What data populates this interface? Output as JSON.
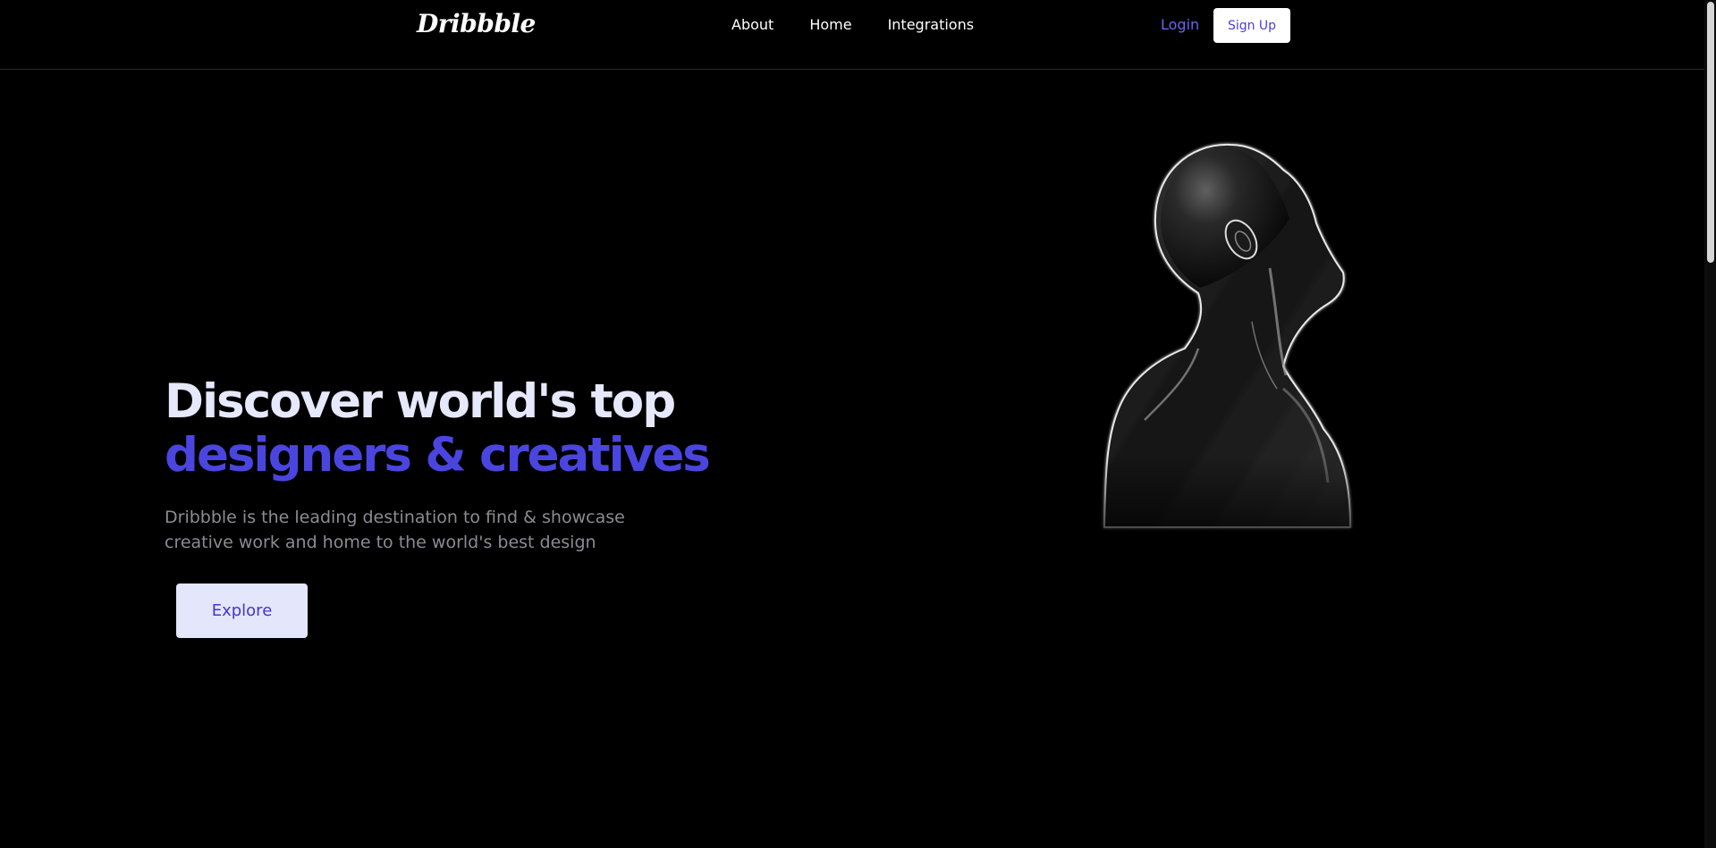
{
  "nav": {
    "logo": "Dribbble",
    "links": [
      "About",
      "Home",
      "Integrations"
    ],
    "login": "Login",
    "signup": "Sign Up"
  },
  "hero": {
    "title_line1": "Discover world's top",
    "title_line2": "designers & creatives",
    "description_line1": "Dribbble is the leading destination to find & showcase",
    "description_line2": "creative work and home to the world's best design",
    "cta": "Explore"
  },
  "colors": {
    "background": "#000000",
    "accent": "#4b45e0",
    "title": "#e6e8fb",
    "cta_bg": "#e4e6fc"
  },
  "icons": {
    "hero_image": "chrome-human-bust-illustration"
  }
}
